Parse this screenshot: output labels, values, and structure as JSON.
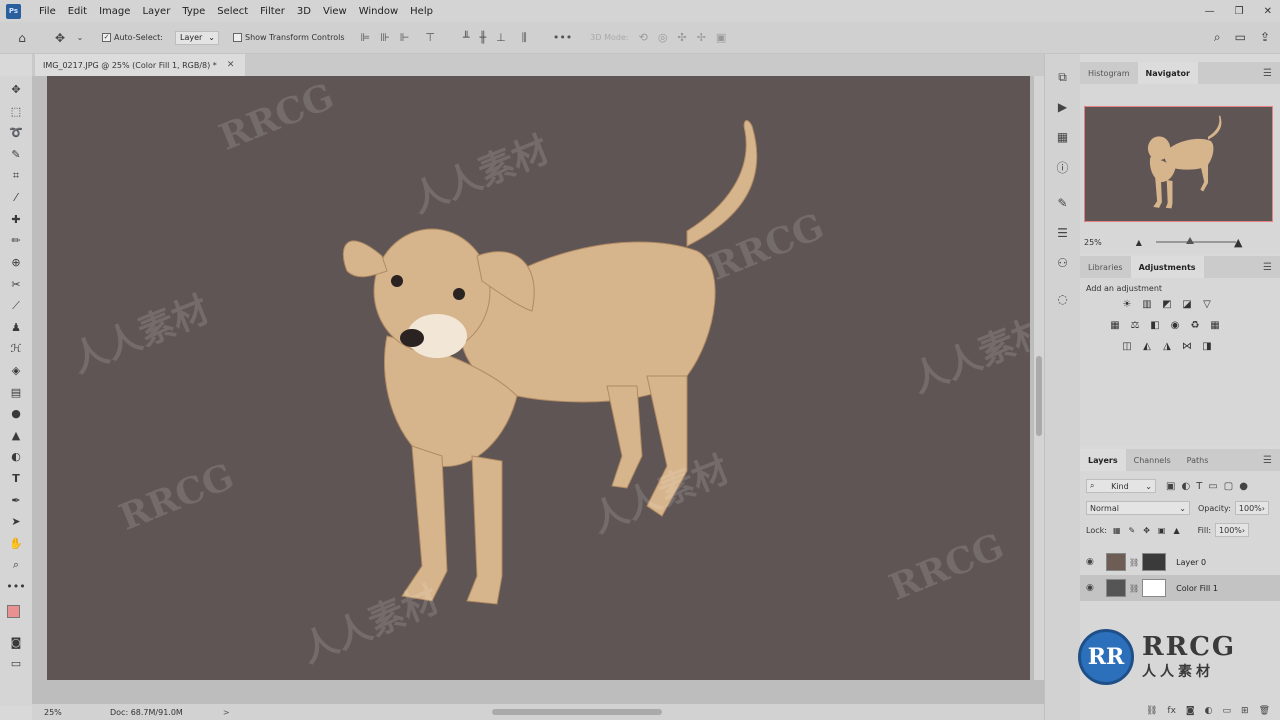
{
  "menu": {
    "app_icon": "Ps",
    "items": [
      "File",
      "Edit",
      "Image",
      "Layer",
      "Type",
      "Select",
      "Filter",
      "3D",
      "View",
      "Window",
      "Help"
    ],
    "window_controls": [
      "—",
      "❐",
      "✕"
    ]
  },
  "options_bar": {
    "auto_select_label": "Auto-Select:",
    "auto_select_checked": true,
    "auto_select_target": "Layer",
    "show_transform_label": "Show Transform Controls",
    "mode_3d_label": "3D Mode:"
  },
  "document": {
    "tab_title": "IMG_0217.JPG @ 25% (Color Fill 1, RGB/8) *",
    "canvas_color": "#605555"
  },
  "status": {
    "zoom": "25%",
    "doc_size": "Doc: 68.7M/91.0M",
    "arrow": ">"
  },
  "colors": {
    "foreground": "#e99090",
    "background": "#ffffff",
    "navigator_frame": "#e38080"
  },
  "navigator_panel": {
    "tabs": [
      "Histogram",
      "Navigator"
    ],
    "active_tab": "Navigator",
    "zoom": "25%"
  },
  "adjustments_panel": {
    "tabs": [
      "Libraries",
      "Adjustments"
    ],
    "active_tab": "Adjustments",
    "title": "Add an adjustment"
  },
  "layers_panel": {
    "tabs": [
      "Layers",
      "Channels",
      "Paths"
    ],
    "active_tab": "Layers",
    "filter_kind": "Kind",
    "blend_mode": "Normal",
    "opacity_label": "Opacity:",
    "opacity_value": "100%",
    "lock_label": "Lock:",
    "fill_label": "Fill:",
    "fill_value": "100%",
    "layers": [
      {
        "name": "Layer 0",
        "visible": true,
        "selected": false
      },
      {
        "name": "Color Fill 1",
        "visible": true,
        "selected": true
      }
    ],
    "bottom_icons": [
      "link-icon",
      "fx-icon",
      "mask-icon",
      "adjustment-icon",
      "group-icon",
      "new-layer-icon",
      "trash-icon"
    ]
  },
  "watermark": {
    "brand": "RRCG",
    "cn": "人人素材"
  },
  "logo": {
    "mark": "RR",
    "big": "RRCG",
    "small": "人人素材"
  }
}
